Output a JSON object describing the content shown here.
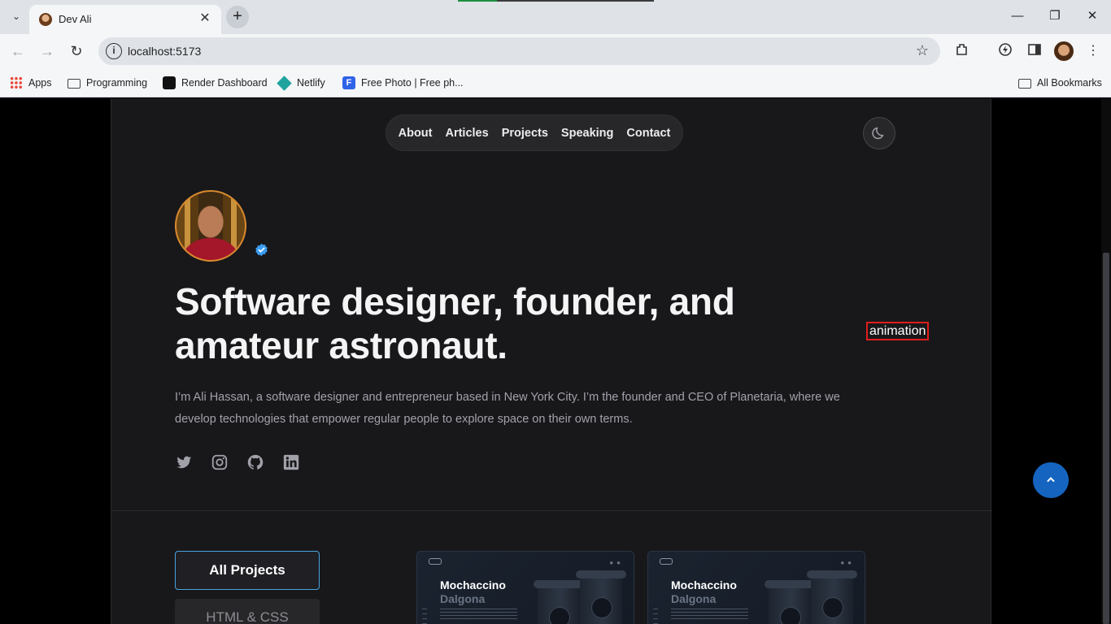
{
  "browser": {
    "tab_title": "Dev Ali",
    "url": "localhost:5173",
    "bookmarks": [
      {
        "label": "Apps",
        "icon": "apps-grid-icon"
      },
      {
        "label": "Programming",
        "icon": "folder-icon"
      },
      {
        "label": "Render Dashboard",
        "icon": "render-icon"
      },
      {
        "label": "Netlify",
        "icon": "netlify-icon"
      },
      {
        "label": "Free Photo | Free ph...",
        "icon": "freepik-icon"
      }
    ],
    "all_bookmarks_label": "All Bookmarks"
  },
  "site": {
    "nav": [
      "About",
      "Articles",
      "Projects",
      "Speaking",
      "Contact"
    ],
    "headline": "Software designer, founder, and amateur astronaut.",
    "annotation_label": "animation",
    "bio": "I’m Ali Hassan, a software designer and entrepreneur based in New York City. I’m the founder and CEO of Planetaria, where we develop technologies that empower regular people to explore space on their own terms.",
    "socials": [
      "twitter-icon",
      "instagram-icon",
      "github-icon",
      "linkedin-icon"
    ],
    "filters": {
      "active": "All Projects",
      "next": "HTML & CSS"
    },
    "projects": [
      {
        "title_line1": "Mochaccino",
        "title_line2": "Dalgona"
      },
      {
        "title_line1": "Mochaccino",
        "title_line2": "Dalgona"
      }
    ],
    "scroll_top_icon": "chevron-up-icon"
  },
  "colors": {
    "page_bg": "#000000",
    "container_bg": "#18181b",
    "accent": "#4aa3df",
    "fab": "#1565c0",
    "avatar_ring": "#d98a2e"
  }
}
